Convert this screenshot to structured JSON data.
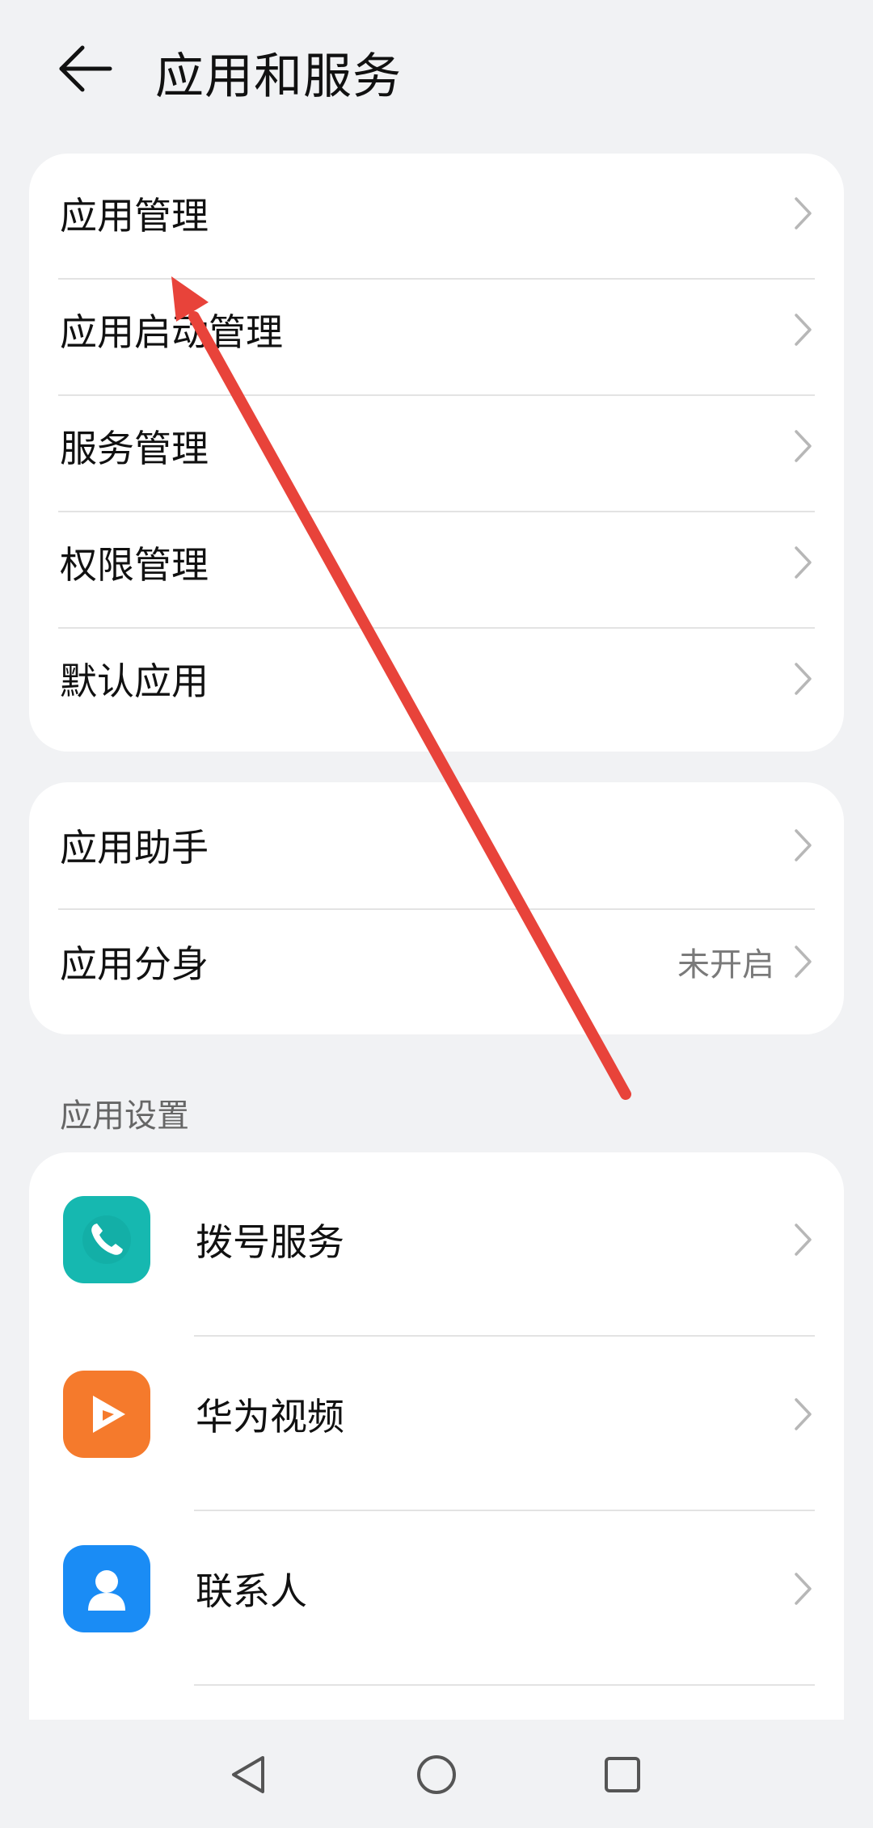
{
  "header": {
    "title": "应用和服务",
    "back_icon": "arrow-left-icon"
  },
  "card1": {
    "items": [
      {
        "label": "应用管理"
      },
      {
        "label": "应用启动管理"
      },
      {
        "label": "服务管理"
      },
      {
        "label": "权限管理"
      },
      {
        "label": "默认应用"
      }
    ]
  },
  "card2": {
    "items": [
      {
        "label": "应用助手",
        "value": ""
      },
      {
        "label": "应用分身",
        "value": "未开启"
      }
    ]
  },
  "app_settings": {
    "section_title": "应用设置",
    "items": [
      {
        "label": "拨号服务",
        "icon": "phone-icon",
        "color": "#16b8b0"
      },
      {
        "label": "华为视频",
        "icon": "video-play-icon",
        "color": "#f57a2c"
      },
      {
        "label": "联系人",
        "icon": "contact-person-icon",
        "color": "#1a8cf5"
      }
    ]
  },
  "annotation": {
    "arrow_color": "#e8433a"
  },
  "navbar": {
    "back_icon": "nav-back-triangle-icon",
    "home_icon": "nav-home-circle-icon",
    "recents_icon": "nav-recents-square-icon"
  }
}
